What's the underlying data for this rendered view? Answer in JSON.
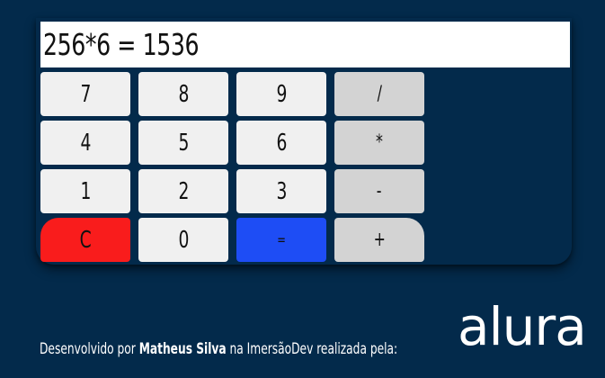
{
  "display": {
    "value": "256*6 = 1536"
  },
  "keypad": {
    "k7": "7",
    "k8": "8",
    "k9": "9",
    "div": "/",
    "k4": "4",
    "k5": "5",
    "k6": "6",
    "mul": "*",
    "k1": "1",
    "k2": "2",
    "k3": "3",
    "sub": "-",
    "clear": "C",
    "k0": "0",
    "equals": "=",
    "add": "+"
  },
  "footer": {
    "prefix": "Desenvolvido por ",
    "author": "Matheus Silva",
    "suffix": " na ImersãoDev realizada pela:",
    "logo": "alura"
  },
  "colors": {
    "background": "#032a4b",
    "clear_button": "#f91c1c",
    "equals_button": "#1e4df5",
    "digit_button": "#f0f0f0",
    "operator_button": "#d3d3d3"
  }
}
